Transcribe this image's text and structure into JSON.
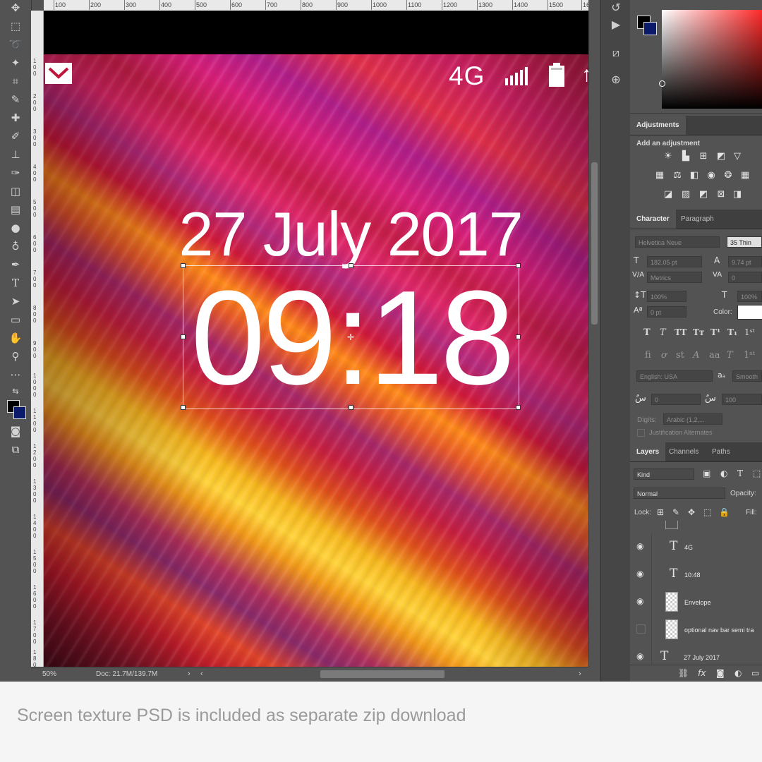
{
  "ruler": {
    "top_ticks": [
      "100",
      "200",
      "300",
      "400",
      "500",
      "600",
      "700",
      "800",
      "900",
      "1000",
      "1100",
      "1200",
      "1300",
      "1400",
      "1500",
      "1600"
    ],
    "left_ticks": [
      "100",
      "200",
      "300",
      "400",
      "500",
      "600",
      "700",
      "800",
      "900",
      "1000",
      "1100",
      "1200",
      "1300",
      "1400",
      "1500",
      "1600",
      "1700",
      "1800"
    ]
  },
  "canvas": {
    "status_network": "4G",
    "date": "27 July 2017",
    "time": "09:18"
  },
  "statusbar": {
    "zoom": "50%",
    "doc": "Doc: 21.7M/139.7M"
  },
  "adjustments": {
    "tab": "Adjustments",
    "heading": "Add an adjustment"
  },
  "character": {
    "tabs": [
      "Character",
      "Paragraph"
    ],
    "font_family": "Helvetica Neue",
    "font_style": "35 Thin",
    "font_size": "182.05 pt",
    "leading": "9.74 pt",
    "kerning": "Metrics",
    "tracking": "0",
    "vscale": "100%",
    "hscale": "100%",
    "baseline": "0 pt",
    "color_label": "Color:",
    "language": "English: USA",
    "aa_label": "aₐ",
    "antialias": "Smooth",
    "ar_field1": "0",
    "ar_field2": "100",
    "digits_label": "Digits:",
    "digits_value": "Arabic (1,2,...",
    "justification": "Justification Alternates"
  },
  "layers": {
    "tabs": [
      "Layers",
      "Channels",
      "Paths"
    ],
    "filter": "Kind",
    "blend": "Normal",
    "opacity_label": "Opacity:",
    "lock_label": "Lock:",
    "fill_label": "Fill:",
    "rows": [
      {
        "name": "4G",
        "type": "text",
        "visible": true
      },
      {
        "name": "10:48",
        "type": "text",
        "visible": true
      },
      {
        "name": "Envelope",
        "type": "image",
        "visible": true
      },
      {
        "name": "optional nav bar semi tra",
        "type": "image",
        "visible": false
      },
      {
        "name": "27 July 2017",
        "type": "text",
        "visible": true
      }
    ]
  },
  "caption": "Screen texture PSD is included as separate zip download"
}
